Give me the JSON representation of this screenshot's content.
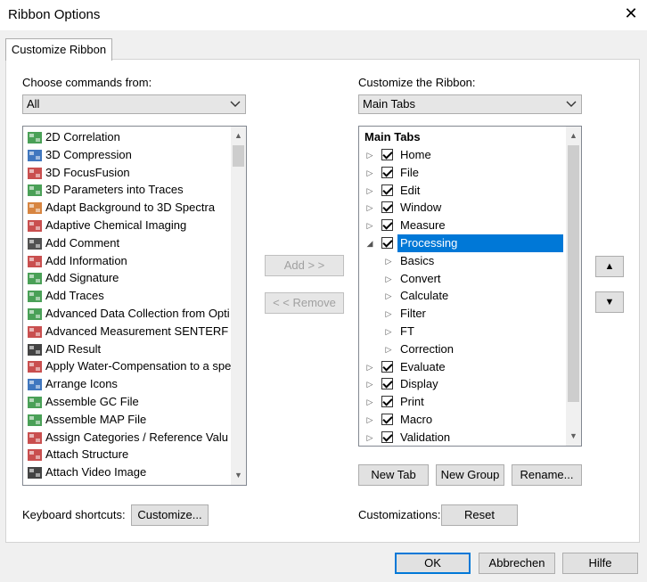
{
  "window": {
    "title": "Ribbon Options",
    "close_glyph": "✕"
  },
  "tab": {
    "label": "Customize Ribbon"
  },
  "left": {
    "label": "Choose commands from:",
    "combo_value": "All",
    "commands": [
      {
        "label": "2D Correlation",
        "icon": "2d-correlation-icon",
        "color": "#2a8f3a"
      },
      {
        "label": "3D Compression",
        "icon": "3d-compression-icon",
        "color": "#1e5fb4"
      },
      {
        "label": "3D FocusFusion",
        "icon": "3d-focusfusion-icon",
        "color": "#c03030"
      },
      {
        "label": "3D Parameters into Traces",
        "icon": "3d-parameters-icon",
        "color": "#2a8f3a"
      },
      {
        "label": "Adapt Background to 3D Spectra",
        "icon": "adapt-background-icon",
        "color": "#d07020"
      },
      {
        "label": "Adaptive Chemical Imaging",
        "icon": "chemical-imaging-icon",
        "color": "#c03030"
      },
      {
        "label": "Add Comment",
        "icon": "text-comment-icon",
        "color": "#333333"
      },
      {
        "label": "Add Information",
        "icon": "add-information-icon",
        "color": "#c03030"
      },
      {
        "label": "Add Signature",
        "icon": "add-signature-icon",
        "color": "#2a8f3a"
      },
      {
        "label": "Add Traces",
        "icon": "add-traces-icon",
        "color": "#2a8f3a"
      },
      {
        "label": "Advanced Data Collection from Opti",
        "icon": "data-collection-icon",
        "color": "#2a8f3a"
      },
      {
        "label": "Advanced Measurement SENTERF",
        "icon": "advanced-measurement-icon",
        "color": "#c03030"
      },
      {
        "label": "AID Result",
        "icon": "aid-result-icon",
        "color": "#222222"
      },
      {
        "label": "Apply Water-Compensation to a spe",
        "icon": "water-compensation-icon",
        "color": "#c03030"
      },
      {
        "label": "Arrange Icons",
        "icon": "arrange-icons-icon",
        "color": "#1e5fb4"
      },
      {
        "label": "Assemble GC File",
        "icon": "assemble-gc-icon",
        "color": "#2a8f3a"
      },
      {
        "label": "Assemble MAP File",
        "icon": "assemble-map-icon",
        "color": "#2a8f3a"
      },
      {
        "label": "Assign Categories / Reference Valu",
        "icon": "assign-categories-icon",
        "color": "#c03030"
      },
      {
        "label": "Attach Structure",
        "icon": "attach-structure-icon",
        "color": "#c03030"
      },
      {
        "label": "Attach Video Image",
        "icon": "attach-video-icon",
        "color": "#222222"
      }
    ],
    "keyboard_label": "Keyboard shortcuts:",
    "customize_button": "Customize..."
  },
  "middle": {
    "add_button": "Add > >",
    "remove_button": "< < Remove"
  },
  "right": {
    "label": "Customize the Ribbon:",
    "combo_value": "Main Tabs",
    "tree_header": "Main Tabs",
    "tree": [
      {
        "label": "Home",
        "level": 0,
        "checked": true,
        "expanded": false
      },
      {
        "label": "File",
        "level": 0,
        "checked": true,
        "expanded": false
      },
      {
        "label": "Edit",
        "level": 0,
        "checked": true,
        "expanded": false
      },
      {
        "label": "Window",
        "level": 0,
        "checked": true,
        "expanded": false
      },
      {
        "label": "Measure",
        "level": 0,
        "checked": true,
        "expanded": false
      },
      {
        "label": "Processing",
        "level": 0,
        "checked": true,
        "expanded": true,
        "selected": true
      },
      {
        "label": "Basics",
        "level": 1
      },
      {
        "label": "Convert",
        "level": 1
      },
      {
        "label": "Calculate",
        "level": 1
      },
      {
        "label": "Filter",
        "level": 1
      },
      {
        "label": "FT",
        "level": 1
      },
      {
        "label": "Correction",
        "level": 1
      },
      {
        "label": "Evaluate",
        "level": 0,
        "checked": true,
        "expanded": false
      },
      {
        "label": "Display",
        "level": 0,
        "checked": true,
        "expanded": false
      },
      {
        "label": "Print",
        "level": 0,
        "checked": true,
        "expanded": false
      },
      {
        "label": "Macro",
        "level": 0,
        "checked": true,
        "expanded": false
      },
      {
        "label": "Validation",
        "level": 0,
        "checked": true,
        "expanded": false
      }
    ],
    "new_tab_button": "New Tab",
    "new_group_button": "New Group",
    "rename_button": "Rename...",
    "customizations_label": "Customizations:",
    "reset_button": "Reset",
    "move_up_glyph": "▲",
    "move_down_glyph": "▼"
  },
  "footer": {
    "ok_button": "OK",
    "cancel_button": "Abbrechen",
    "help_button": "Hilfe"
  },
  "colors": {
    "selection": "#0078d7",
    "accent_border": "#0078d7"
  }
}
